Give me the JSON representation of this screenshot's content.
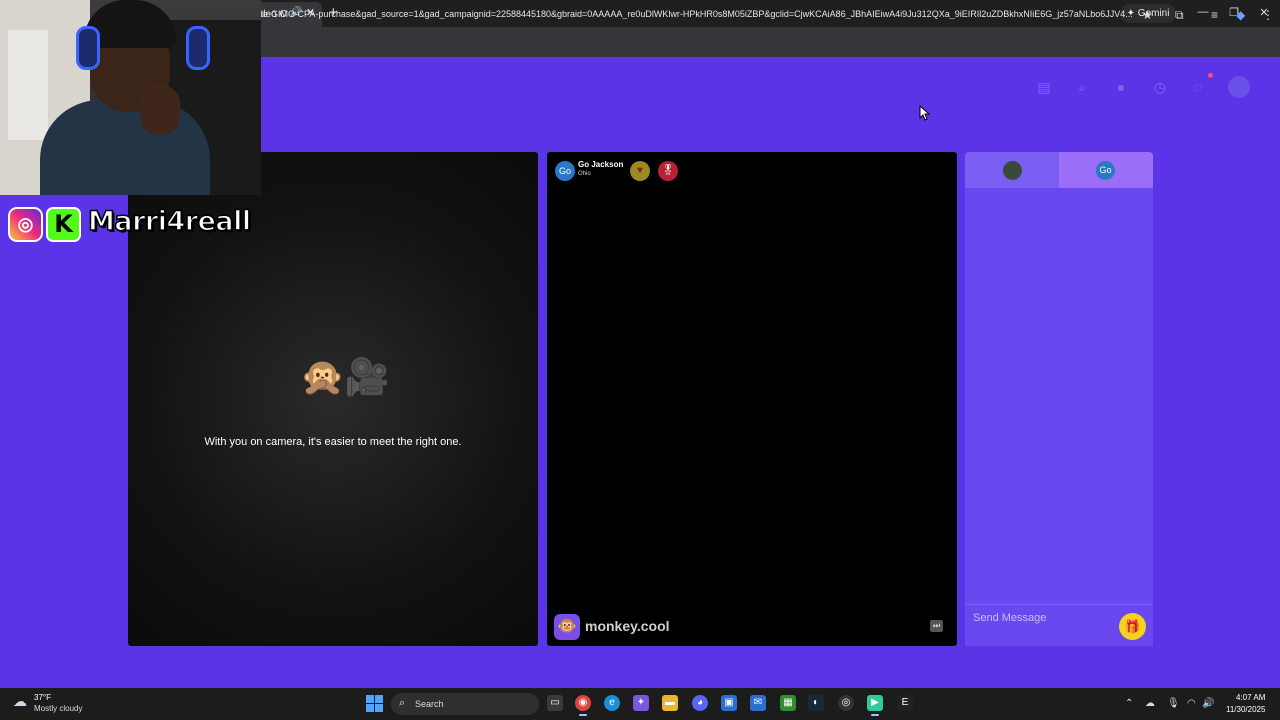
{
  "browser": {
    "tab_title": "deo C",
    "new_tab_symbol": "+",
    "gemini_label": "✦ Gemini",
    "url": "le-GIMC-CPA-purchase&gad_source=1&gad_campaignid=22588445180&gbraid=0AAAAA_re0uDlWKlwr-HPkHR0s8M05iZBP&gclid=CjwKCAiA86_JBhAIEiwA4i9Ju312QXa_9iEIRIl2uZDBkhxNIiE6G_jz57aNLbo6JJV4..."
  },
  "site": {
    "header_icons": [
      "shop-icon",
      "search-icon",
      "profile-icon",
      "history-icon",
      "chat-icon",
      "avatar-icon"
    ]
  },
  "self_video": {
    "emoji": "🙊🎥",
    "camera_prompt": "With you on camera, it's easier to meet the right one."
  },
  "peer": {
    "avatar_initials": "Go",
    "name": "Go Jackson",
    "location": "Ohio",
    "badge1": "♥",
    "badge2": "🎖"
  },
  "brand": {
    "logo": "🐵",
    "name": "monkey.cool"
  },
  "chat": {
    "tab_right_initials": "Go",
    "input_placeholder": "Send Message",
    "gift_icon": "🎁"
  },
  "overlay": {
    "instagram_glyph": "◎",
    "kick_glyph": "K",
    "handle": "Marri4reall"
  },
  "taskbar": {
    "weather_temp": "37°F",
    "weather_desc": "Mostly cloudy",
    "search_label": "Search",
    "time": "4:07 AM",
    "date": "11/30/2025"
  }
}
